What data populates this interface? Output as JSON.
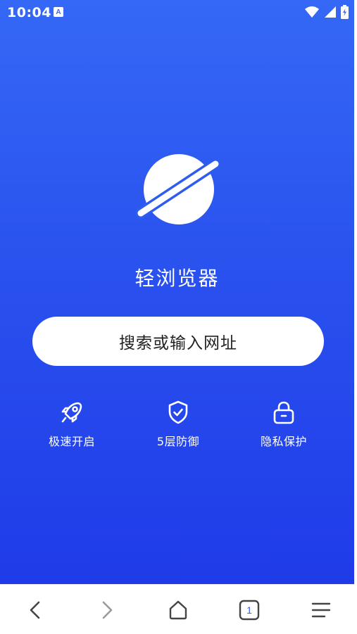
{
  "status_bar": {
    "time": "10:04",
    "app_icon_letter": "A"
  },
  "app": {
    "title": "轻浏览器"
  },
  "search": {
    "placeholder": "搜索或输入网址"
  },
  "features": [
    {
      "icon": "rocket-icon",
      "label": "极速开启"
    },
    {
      "icon": "shield-check-icon",
      "label": "5层防御"
    },
    {
      "icon": "lock-icon",
      "label": "隐私保护"
    }
  ],
  "bottom_nav": {
    "tab_count": "1"
  },
  "colors": {
    "gradient_top": "#3568f6",
    "gradient_bottom": "#1f3be9",
    "accent": "#3a5ce8",
    "nav_icon": "#444444",
    "nav_icon_disabled": "#9a9a9a"
  }
}
